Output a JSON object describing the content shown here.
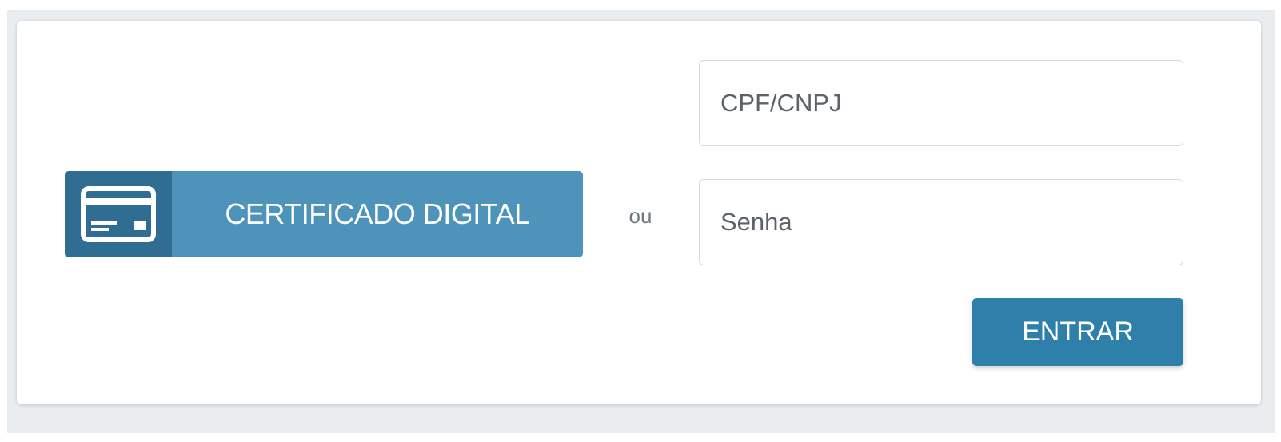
{
  "login": {
    "certificate_button_label": "CERTIFICADO DIGITAL",
    "certificate_icon": "credit-card-icon",
    "separator_text": "ou",
    "cpf_field": {
      "placeholder": "CPF/CNPJ",
      "value": ""
    },
    "password_field": {
      "placeholder": "Senha",
      "value": ""
    },
    "submit_label": "ENTRAR"
  },
  "colors": {
    "page_background": "#e9edf0",
    "card_background": "#ffffff",
    "certificate_button": "#4e93b9",
    "certificate_icon_bg": "#2f6d92",
    "submit_button": "#2e80aa",
    "divider": "#cfd4d8"
  }
}
